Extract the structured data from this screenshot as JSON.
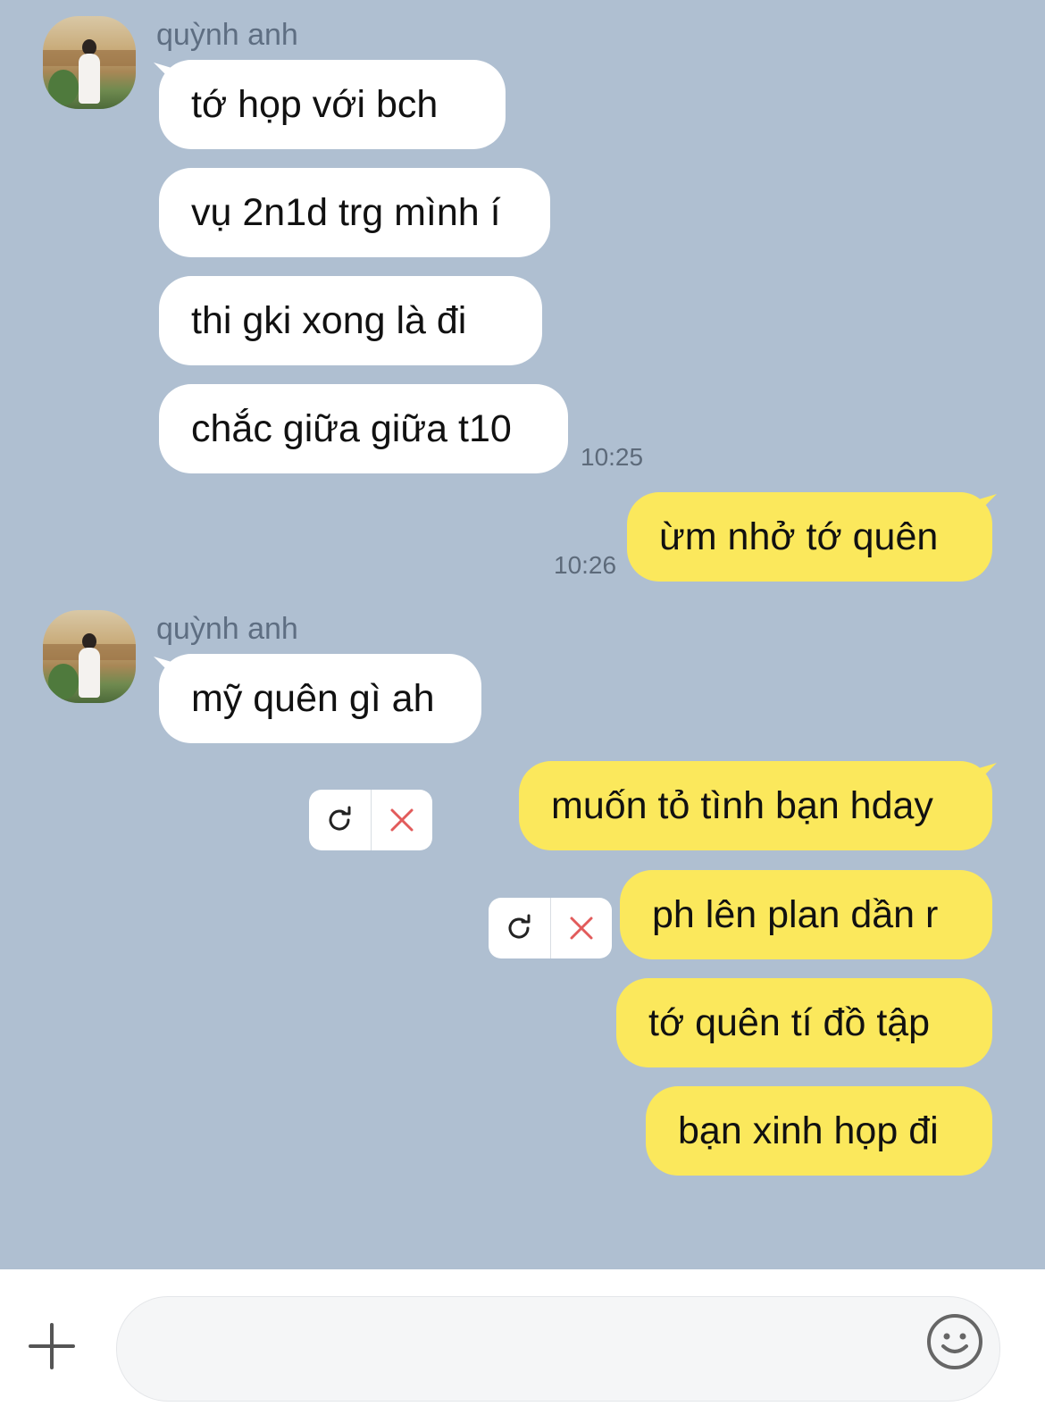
{
  "conversation": {
    "contact_name": "quỳnh anh",
    "messages": [
      {
        "from": "contact",
        "text": "tớ họp với bch"
      },
      {
        "from": "contact",
        "text": "vụ 2n1d trg mình í"
      },
      {
        "from": "contact",
        "text": "thi gki xong là đi"
      },
      {
        "from": "contact",
        "text": "chắc giữa giữa t10",
        "time": "10:25"
      },
      {
        "from": "me",
        "text": "ừm nhở tớ quên",
        "time": "10:26"
      },
      {
        "from": "contact",
        "text": "mỹ quên gì ah"
      },
      {
        "from": "me",
        "text": "muốn tỏ tình bạn hday",
        "status": "failed"
      },
      {
        "from": "me",
        "text": "ph lên plan dần r",
        "status": "failed"
      },
      {
        "from": "me",
        "text": "tớ quên tí đồ tập"
      },
      {
        "from": "me",
        "text": "bạn xinh họp đi"
      }
    ]
  },
  "composer": {
    "input_value": "",
    "plus_icon": "plus-icon",
    "emoji_icon": "emoji-icon"
  },
  "colors": {
    "background": "#afbfd1",
    "incoming_bubble": "#ffffff",
    "outgoing_bubble": "#fbe85c",
    "error_x": "#e25b5b"
  }
}
